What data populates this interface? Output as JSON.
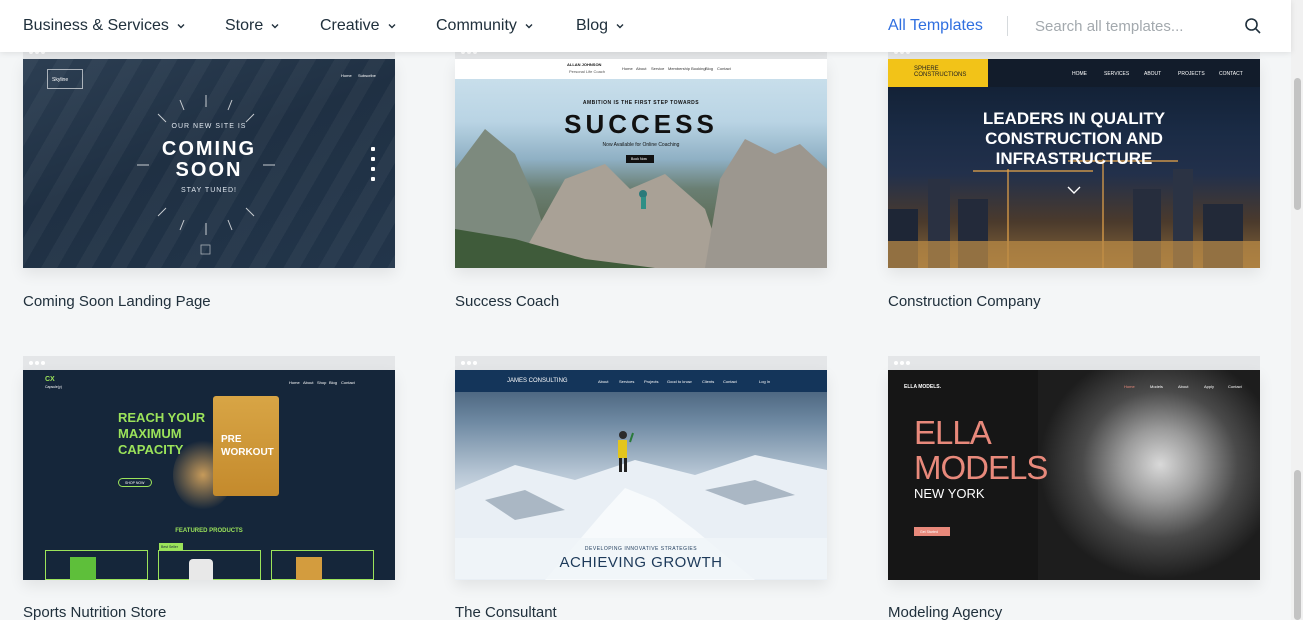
{
  "nav": {
    "items": [
      {
        "label": "Business & Services"
      },
      {
        "label": "Store"
      },
      {
        "label": "Creative"
      },
      {
        "label": "Community"
      },
      {
        "label": "Blog"
      }
    ],
    "all_templates": "All Templates",
    "search_placeholder": "Search all templates..."
  },
  "templates": [
    {
      "title": "Coming Soon Landing Page",
      "thumb": {
        "logo": "Skyline",
        "menu": [
          "Home",
          "Subscribe"
        ],
        "kicker": "OUR NEW SITE IS",
        "headline": [
          "COMING",
          "SOON"
        ],
        "sub": "STAY TUNED!"
      }
    },
    {
      "title": "Success Coach",
      "thumb": {
        "brand": "ALLAN JOHNSON",
        "tagline": "Personal Life Coach",
        "menu": [
          "Home",
          "About",
          "Service",
          "Membership Booking",
          "Blog",
          "Contact"
        ],
        "kicker": "AMBITION IS THE FIRST STEP TOWARDS",
        "headline": "SUCCESS",
        "sub": "Now Available for Online Coaching",
        "button": "Book Now"
      }
    },
    {
      "title": "Construction Company",
      "thumb": {
        "logo": [
          "SPHERE",
          "CONSTRUCTIONS"
        ],
        "menu": [
          "HOME",
          "SERVICES",
          "ABOUT",
          "PROJECTS",
          "CONTACT"
        ],
        "headline": [
          "LEADERS IN QUALITY",
          "CONSTRUCTION AND",
          "INFRASTRUCTURE"
        ]
      }
    },
    {
      "title": "Sports Nutrition Store",
      "thumb": {
        "logo": "CX",
        "logo_sub": "Capsule(y)",
        "menu": [
          "Home",
          "About",
          "Shop",
          "Blog",
          "Contact"
        ],
        "headline": [
          "REACH YOUR",
          "MAXIMUM",
          "CAPACITY"
        ],
        "button": "SHOP NOW",
        "product": [
          "PRE",
          "WORKOUT"
        ],
        "section": "FEATURED PRODUCTS",
        "badge": "Best Seller"
      }
    },
    {
      "title": "The Consultant",
      "thumb": {
        "brand": "JAMES CONSULTING",
        "menu": [
          "About",
          "Services",
          "Projects",
          "Good to know",
          "Clients",
          "Contact",
          "Log In"
        ],
        "kicker": "DEVELOPING INNOVATIVE STRATEGIES",
        "headline": "ACHIEVING GROWTH"
      }
    },
    {
      "title": "Modeling Agency",
      "thumb": {
        "brand": "ELLA MODELS.",
        "menu": [
          "Home",
          "Models",
          "About",
          "Apply",
          "Contact"
        ],
        "headline": [
          "ELLA",
          "MODELS"
        ],
        "sub": "NEW YORK",
        "button": "Get Started"
      }
    }
  ],
  "colors": {
    "accent": "#2f6fe0",
    "text": "#20303c",
    "page_bg": "#f4f6f7",
    "placeholder": "#a3a9ae"
  },
  "icons": [
    "chevron-down-icon",
    "search-icon"
  ]
}
